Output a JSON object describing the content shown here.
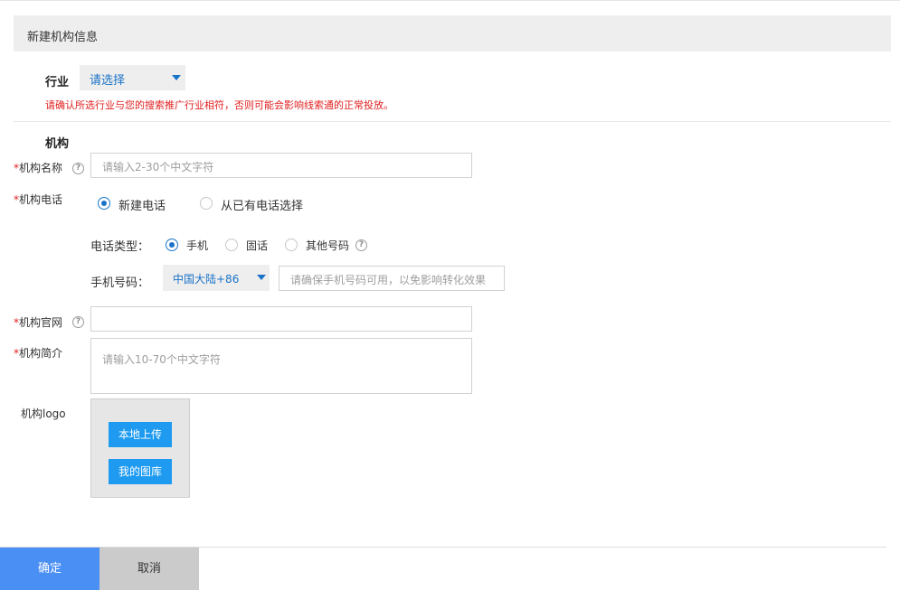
{
  "header": {
    "title": "新建机构信息"
  },
  "industry": {
    "label": "行业",
    "select_value": "请选择",
    "warning": "请确认所选行业与您的搜索推广行业相符，否则可能会影响线索通的正常投放。"
  },
  "org": {
    "section_label": "机构",
    "name": {
      "required_mark": "*",
      "label": "机构名称",
      "placeholder": "请输入2-30个中文字符"
    },
    "phone": {
      "required_mark": "*",
      "label": "机构电话",
      "mode_options": [
        {
          "label": "新建电话",
          "checked": true
        },
        {
          "label": "从已有电话选择",
          "checked": false
        }
      ],
      "type_label": "电话类型：",
      "type_options": [
        {
          "label": "手机",
          "checked": true
        },
        {
          "label": "固话",
          "checked": false
        },
        {
          "label": "其他号码",
          "checked": false
        }
      ],
      "mobile_label": "手机号码：",
      "region_value": "中国大陆+86",
      "mobile_placeholder": "请确保手机号码可用，以免影响转化效果"
    },
    "website": {
      "required_mark": "*",
      "label": "机构官网",
      "value": ""
    },
    "intro": {
      "required_mark": "*",
      "label": "机构简介",
      "placeholder": "请输入10-70个中文字符"
    },
    "logo": {
      "label": "机构logo",
      "upload_label": "本地上传",
      "gallery_label": "我的图库"
    }
  },
  "footer": {
    "ok_label": "确定",
    "cancel_label": "取消"
  },
  "help_glyph": "?",
  "colors": {
    "accent": "#1a73c8",
    "ok_button": "#4a8ff4",
    "upload_button": "#1e9bf0",
    "warning": "#e02020"
  }
}
